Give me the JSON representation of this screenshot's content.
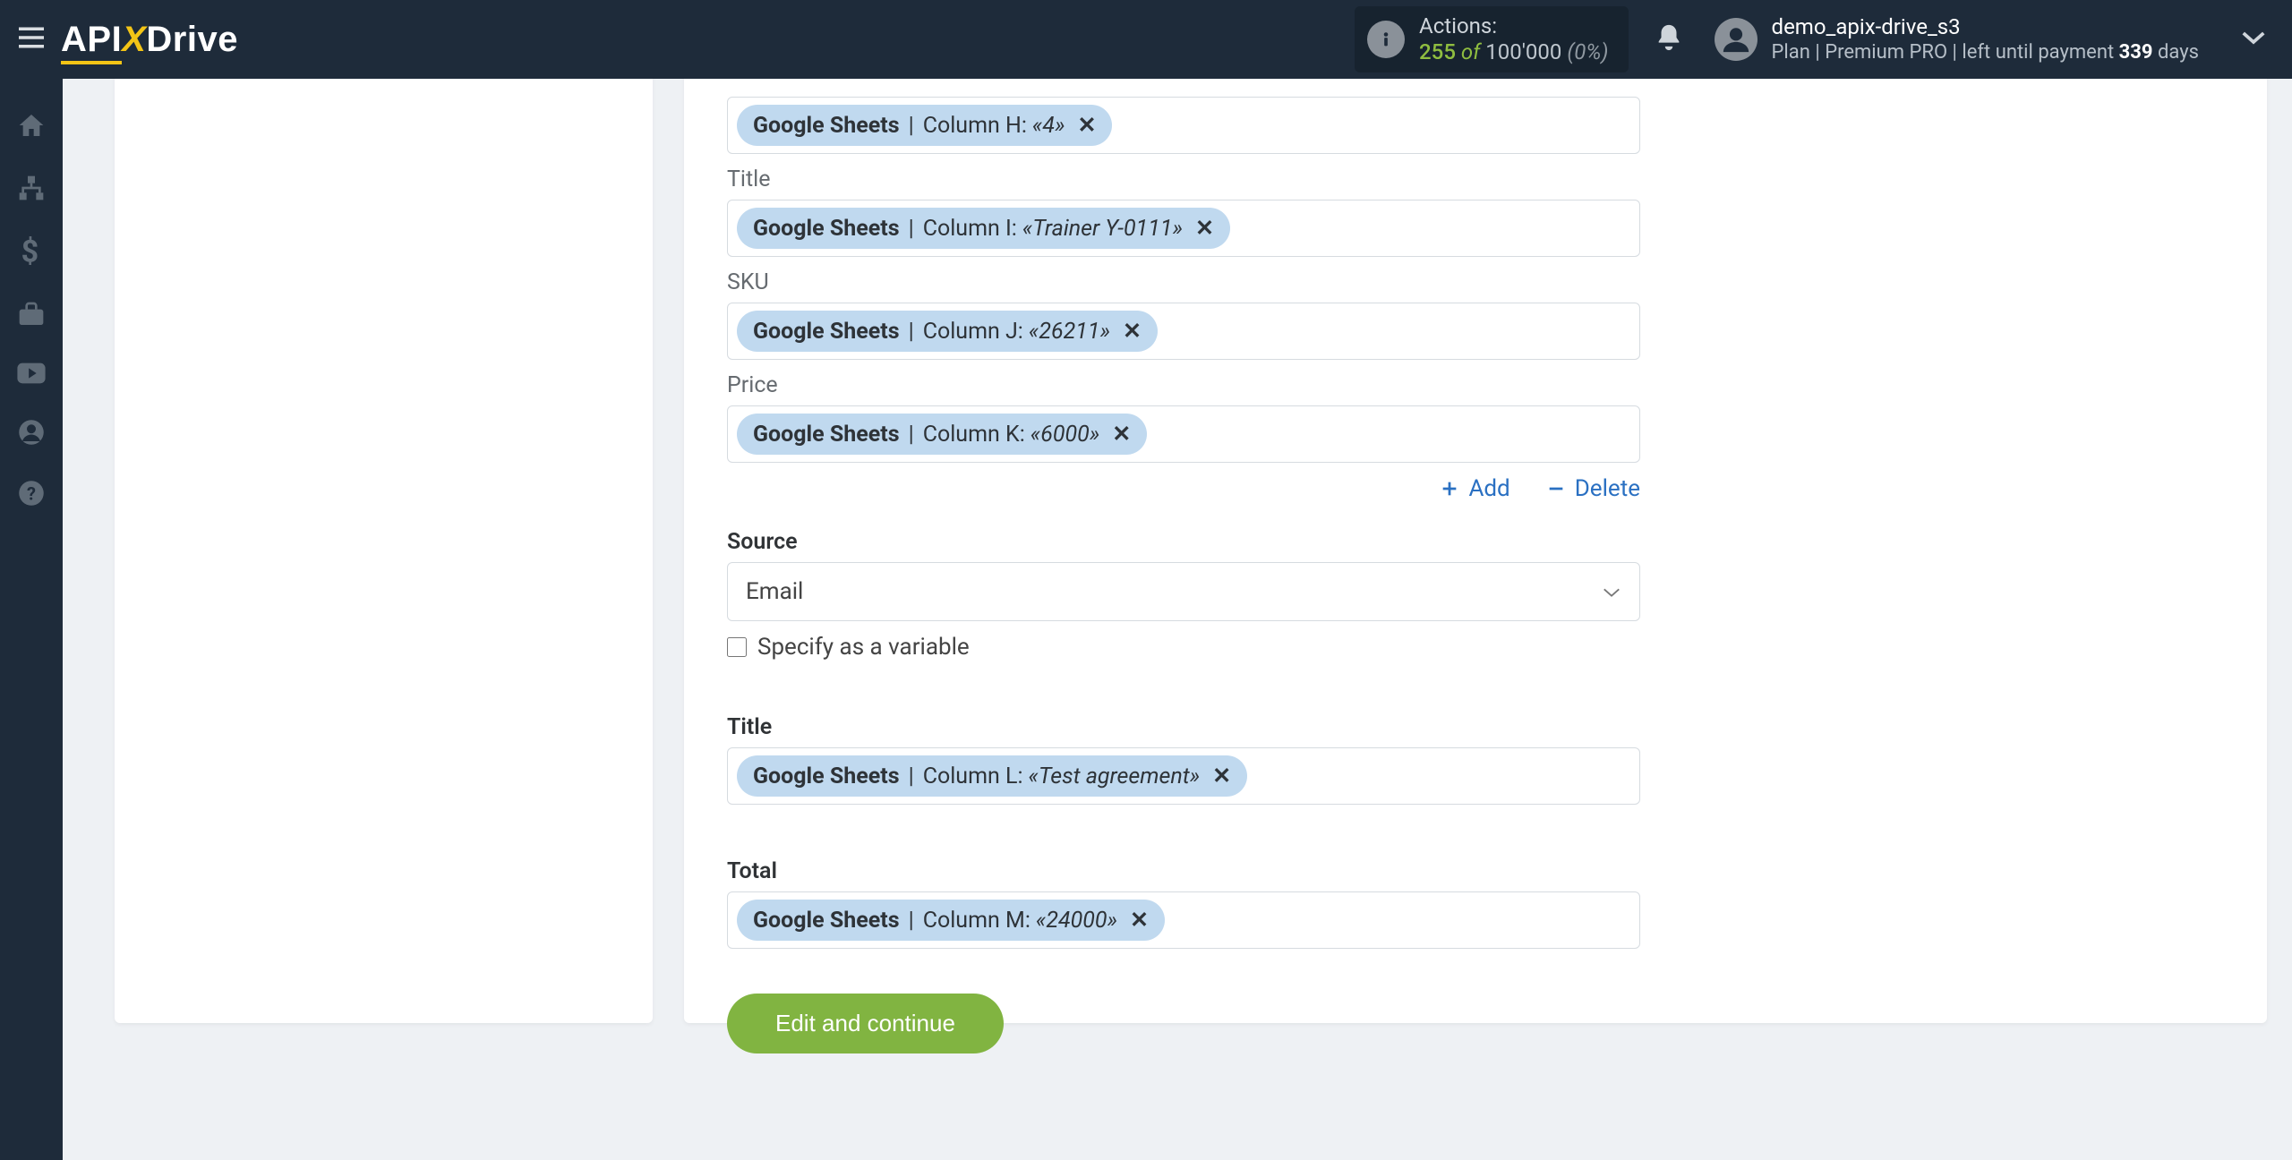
{
  "header": {
    "logo_api": "API",
    "logo_drive": "Drive",
    "actions_label": "Actions:",
    "actions_count": "255",
    "actions_of": "of",
    "actions_total": "100'000",
    "actions_pct": "(0%)",
    "username": "demo_apix-drive_s3",
    "plan_prefix": "Plan  |",
    "plan_name": "Premium PRO",
    "plan_suffix": "|  left until payment",
    "days_value": "339",
    "days_label": "days"
  },
  "fields": {
    "qty": {
      "svc": "Google Sheets",
      "col": "Column H:",
      "val": "«4»"
    },
    "title1": {
      "label": "Title",
      "svc": "Google Sheets",
      "col": "Column I:",
      "val": "«Trainer Y-0111»"
    },
    "sku": {
      "label": "SKU",
      "svc": "Google Sheets",
      "col": "Column J:",
      "val": "«26211»"
    },
    "price": {
      "label": "Price",
      "svc": "Google Sheets",
      "col": "Column K:",
      "val": "«6000»"
    },
    "source": {
      "label": "Source",
      "selected": "Email",
      "checkbox_label": "Specify as a variable"
    },
    "title2": {
      "label": "Title",
      "svc": "Google Sheets",
      "col": "Column L:",
      "val": "«Test agreement»"
    },
    "total": {
      "label": "Total",
      "svc": "Google Sheets",
      "col": "Column M:",
      "val": "«24000»"
    }
  },
  "actions": {
    "add": "Add",
    "delete": "Delete",
    "submit": "Edit and continue"
  }
}
